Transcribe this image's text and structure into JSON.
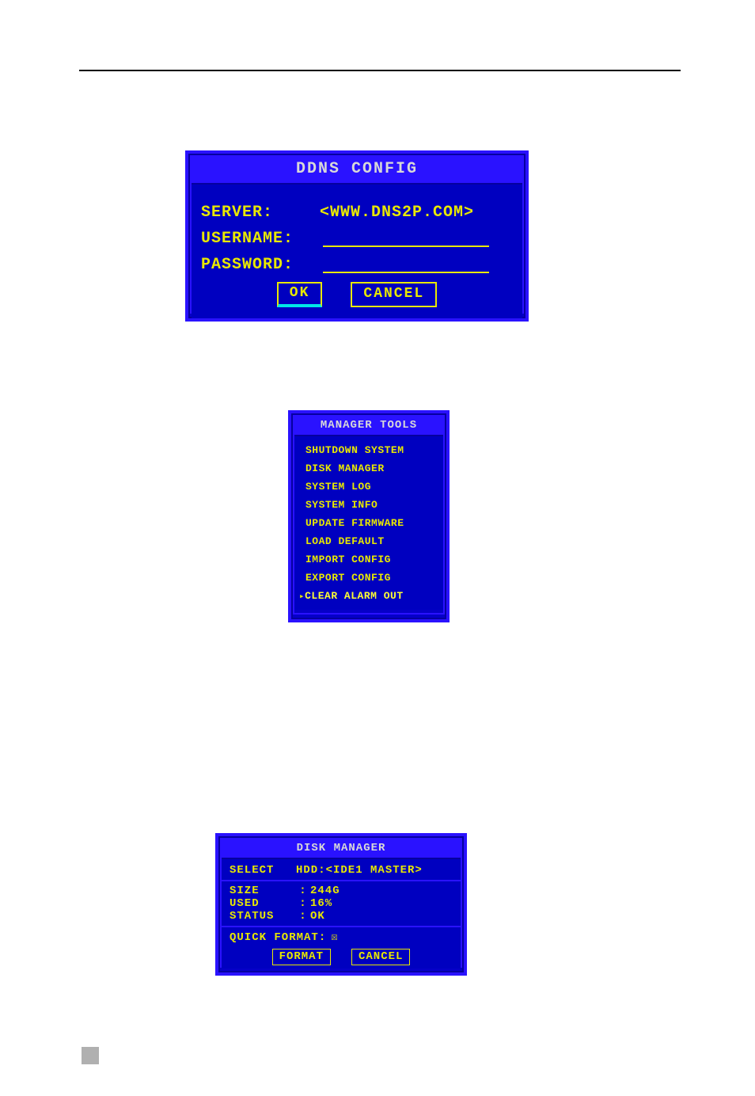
{
  "ddns": {
    "title": "DDNS   CONFIG",
    "server_label": "SERVER:",
    "server_value": "<WWW.DNS2P.COM>",
    "username_label": "USERNAME:",
    "username_value": "",
    "password_label": "PASSWORD:",
    "password_value": "",
    "ok_label": "OK",
    "cancel_label": "CANCEL"
  },
  "manager_tools": {
    "title": "MANAGER TOOLS",
    "items": [
      {
        "label": "SHUTDOWN SYSTEM"
      },
      {
        "label": "DISK MANAGER"
      },
      {
        "label": "SYSTEM LOG"
      },
      {
        "label": "SYSTEM INFO"
      },
      {
        "label": "UPDATE FIRMWARE"
      },
      {
        "label": "LOAD DEFAULT"
      },
      {
        "label": "IMPORT CONFIG"
      },
      {
        "label": "EXPORT CONFIG"
      },
      {
        "label": "CLEAR ALARM OUT"
      }
    ],
    "selected_index": 8
  },
  "disk_manager": {
    "title": "DISK MANAGER",
    "select_label": "SELECT",
    "select_value": "HDD:<IDE1 MASTER>",
    "size_label": "SIZE",
    "size_value": "244G",
    "used_label": "USED",
    "used_value": "16%",
    "status_label": "STATUS",
    "status_value": "OK",
    "quick_format_label": "QUICK FORMAT:",
    "quick_format_checked": true,
    "format_label": "FORMAT",
    "cancel_label": "CANCEL"
  }
}
